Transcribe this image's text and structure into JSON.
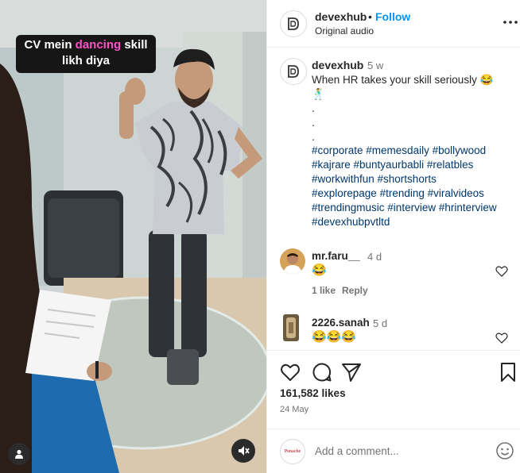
{
  "video": {
    "overlay_text_before": "CV mein ",
    "overlay_text_highlight": "dancing",
    "overlay_text_after": " skill",
    "overlay_text_line2": "likh diya",
    "highlight_color": "#ff52c8"
  },
  "header": {
    "username": "devexhub",
    "separator": "•",
    "follow_label": "Follow",
    "audio_label": "Original audio",
    "more_icon": "more-horizontal-icon"
  },
  "post_caption": {
    "username": "devexhub",
    "time": "5 w",
    "text": "When HR takes your skill seriously 😂",
    "emoji_line": "🕺",
    "dots": [
      ".",
      ".",
      "."
    ],
    "hashtag_lines": [
      "#corporate #memesdaily #bollywood",
      "#kajrare #buntyaurbabli #relatbles",
      "#workwithfun #shortshorts",
      "#explorepage #trending #viralvideos",
      "#trendingmusic #interview #hrinterview",
      "#devexhubpvtltd"
    ]
  },
  "comments": [
    {
      "username": "mr.faru__",
      "time": "4 d",
      "text": "😂",
      "likes": "1 like",
      "reply_label": "Reply"
    },
    {
      "username": "2226.sanah",
      "time": "5 d",
      "text": "😂😂😂"
    }
  ],
  "actions": {
    "like_icon": "heart-icon",
    "comment_icon": "comment-icon",
    "share_icon": "share-icon",
    "save_icon": "bookmark-icon",
    "likes_count": "161,582 likes",
    "date": "24 May"
  },
  "add_comment": {
    "placeholder": "Add a comment...",
    "avatar_text": "Punache"
  },
  "colors": {
    "link_blue": "#0095f6",
    "hashtag": "#00376b",
    "muted": "#737373",
    "border": "#efefef"
  }
}
